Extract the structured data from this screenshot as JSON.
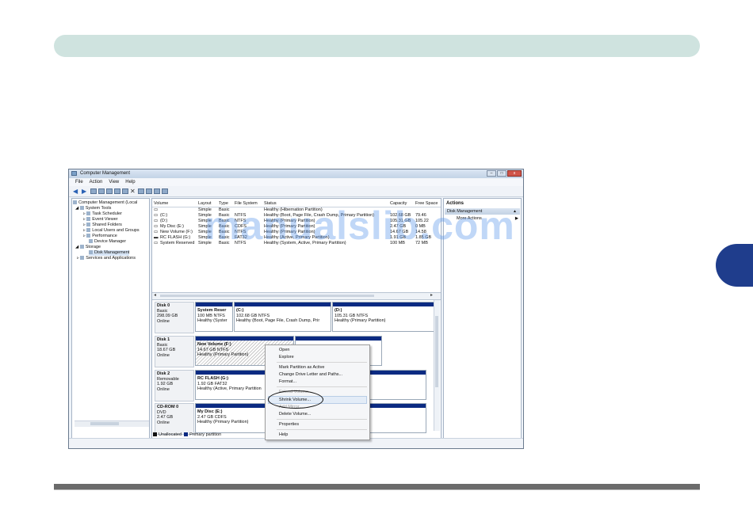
{
  "watermark": "manualslib.com",
  "window": {
    "title": "Computer Management",
    "buttons": {
      "minimize": "–",
      "maximize": "□",
      "close": "x"
    },
    "menu": [
      "File",
      "Action",
      "View",
      "Help"
    ]
  },
  "tree": {
    "items": [
      "Computer Management (Local",
      "System Tools",
      "Task Scheduler",
      "Event Viewer",
      "Shared Folders",
      "Local Users and Groups",
      "Performance",
      "Device Manager",
      "Storage",
      "Disk Management",
      "Services and Applications"
    ]
  },
  "volumes": {
    "headers": [
      "Volume",
      "Layout",
      "Type",
      "File System",
      "Status",
      "Capacity",
      "Free Space"
    ],
    "rows": [
      [
        "",
        "Simple",
        "Basic",
        "",
        "Healthy (Hibernation Partition)",
        "",
        ""
      ],
      [
        "(C:)",
        "Simple",
        "Basic",
        "NTFS",
        "Healthy (Boot, Page File, Crash Dump, Primary Partition)",
        "102.68 GB",
        "79.46"
      ],
      [
        "(D:)",
        "Simple",
        "Basic",
        "NTFS",
        "Healthy (Primary Partition)",
        "105.31 GB",
        "105.22"
      ],
      [
        "My Disc (E:)",
        "Simple",
        "Basic",
        "CDFS",
        "Healthy (Primary Partition)",
        "2.47 GB",
        "0 MB"
      ],
      [
        "New Volume (F:)",
        "Simple",
        "Basic",
        "NTFS",
        "Healthy (Primary Partition)",
        "14.67 GB",
        "14.58"
      ],
      [
        "RC FLASH (G:)",
        "Simple",
        "Basic",
        "FAT32",
        "Healthy (Active, Primary Partition)",
        "1.91 GB",
        "1.85 GB"
      ],
      [
        "System Reserved",
        "Simple",
        "Basic",
        "NTFS",
        "Healthy (System, Active, Primary Partition)",
        "100 MB",
        "72 MB"
      ]
    ]
  },
  "disks": [
    {
      "name": "Disk 0",
      "type": "Basic",
      "size": "298.09 GB",
      "status": "Online",
      "partitions": [
        {
          "name": "System Reser",
          "line2": "100 MB NTFS",
          "line3": "Healthy (Syster"
        },
        {
          "name": "(C:)",
          "line2": "102.68 GB NTFS",
          "line3": "Healthy (Boot, Page File, Crash Dump, Prir"
        },
        {
          "name": "(D:)",
          "line2": "105.31 GB NTFS",
          "line3": "Healthy (Primary Partition)"
        }
      ]
    },
    {
      "name": "Disk 1",
      "type": "Basic",
      "size": "18.67 GB",
      "status": "Online",
      "partitions": [
        {
          "name": "New Volume (F:)",
          "line2": "14.67 GB NTFS",
          "line3": "Healthy (Primary Partition)"
        }
      ]
    },
    {
      "name": "Disk 2",
      "type": "Removable",
      "size": "1.92 GB",
      "status": "Online",
      "partitions": [
        {
          "name": "RC FLASH (G:)",
          "line2": "1.92 GB FAT32",
          "line3": "Healthy (Active, Primary Partition"
        }
      ]
    },
    {
      "name": "CD-ROM 0",
      "type": "DVD",
      "size": "2.47 GB",
      "status": "Online",
      "partitions": [
        {
          "name": "My Disc (E:)",
          "line2": "2.47 GB CDFS",
          "line3": "Healthy (Primary Partition)"
        }
      ]
    }
  ],
  "legend": {
    "unallocated": "Unallocated",
    "primary": "Primary partition"
  },
  "actions": {
    "header": "Actions",
    "section": "Disk Management",
    "more": "More Actions"
  },
  "context_menu": {
    "items": [
      "Open",
      "Explore",
      "Mark Partition as Active",
      "Change Drive Letter and Paths...",
      "Format...",
      "Extend Volume...",
      "Shrink Volume...",
      "Add Mirror...",
      "Delete Volume...",
      "Properties",
      "Help"
    ],
    "selected": "Shrink Volume..."
  },
  "colors": {
    "band": "#cfe3df",
    "tab": "#1f3d8c",
    "partition_bar": "#0b2a82"
  }
}
